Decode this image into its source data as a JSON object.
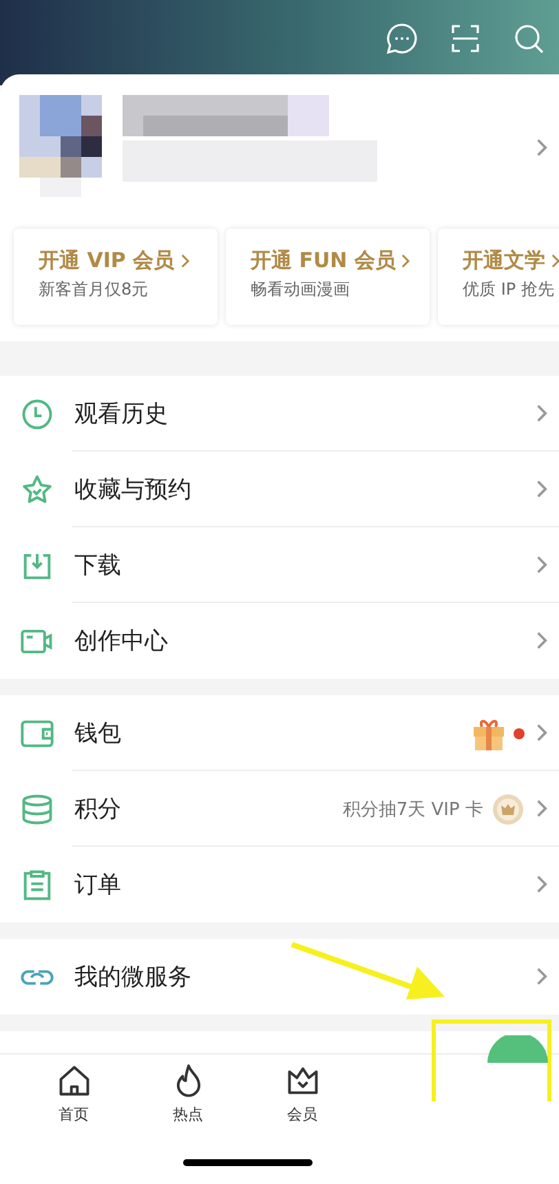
{
  "vip_cards": [
    {
      "title": "开通 VIP 会员",
      "subtitle": "新客首月仅8元"
    },
    {
      "title": "开通 FUN 会员",
      "subtitle": "畅看动画漫画"
    },
    {
      "title": "开通文学",
      "subtitle": "优质 IP 抢先"
    }
  ],
  "menu_groups": [
    [
      {
        "kind": "clock",
        "label": "观看历史"
      },
      {
        "kind": "star",
        "label": "收藏与预约"
      },
      {
        "kind": "download",
        "label": "下载"
      },
      {
        "kind": "camera",
        "label": "创作中心"
      }
    ],
    [
      {
        "kind": "wallet",
        "label": "钱包",
        "extra": {
          "kind": "gift",
          "unread": true
        }
      },
      {
        "kind": "coins",
        "label": "积分",
        "extra": {
          "kind": "hint",
          "text": "积分抽7天 VIP 卡"
        }
      },
      {
        "kind": "clipboard",
        "label": "订单"
      }
    ],
    [
      {
        "kind": "link",
        "label": "我的微服务"
      }
    ]
  ],
  "tab_bar": [
    {
      "kind": "home",
      "label": "首页"
    },
    {
      "kind": "flame",
      "label": "热点"
    },
    {
      "kind": "crown",
      "label": "会员"
    }
  ]
}
